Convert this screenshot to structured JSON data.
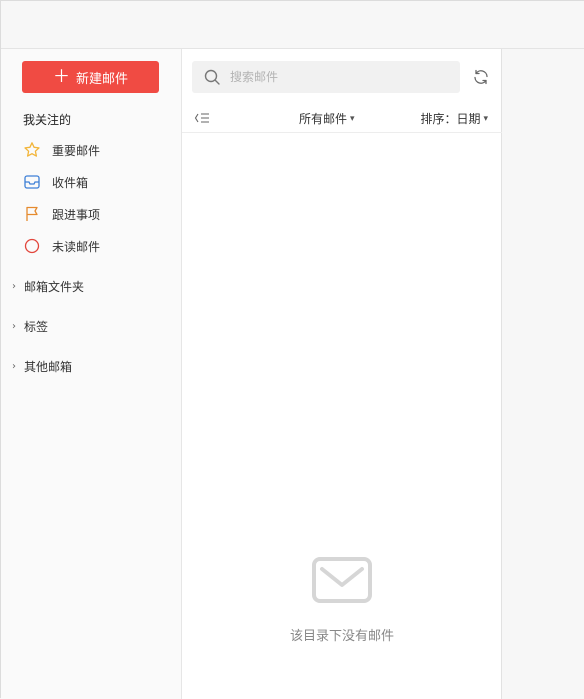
{
  "sidebar": {
    "compose_label": "新建邮件",
    "section_title": "我关注的",
    "items": [
      {
        "label": "重要邮件",
        "icon": "star-icon",
        "color": "#f2b53a"
      },
      {
        "label": "收件箱",
        "icon": "inbox-icon",
        "color": "#3d7fd6"
      },
      {
        "label": "跟进事项",
        "icon": "flag-icon",
        "color": "#e58a2d"
      },
      {
        "label": "未读邮件",
        "icon": "circle-icon",
        "color": "#e2463c"
      }
    ],
    "groups": [
      {
        "label": "邮箱文件夹"
      },
      {
        "label": "标签"
      },
      {
        "label": "其他邮箱"
      }
    ]
  },
  "search": {
    "placeholder": "搜索邮件",
    "value": ""
  },
  "toolbar": {
    "filter_label": "所有邮件",
    "sort_label": "排序：日期"
  },
  "empty_state": {
    "message": "该目录下没有邮件"
  },
  "colors": {
    "accent": "#f04b43"
  }
}
